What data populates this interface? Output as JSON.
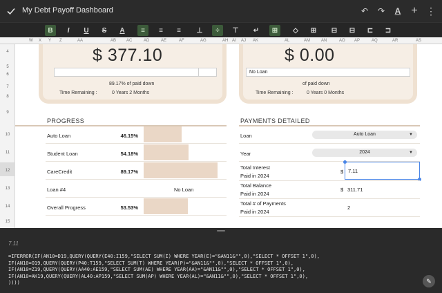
{
  "app": {
    "title": "My Debt Payoff Dashboard"
  },
  "columns": [
    "W",
    "X",
    "Y",
    "Z",
    "AA",
    "AB",
    "AC",
    "AD",
    "AE",
    "AF",
    "AG",
    "AH",
    "AI",
    "AJ",
    "AK",
    "AL",
    "AM",
    "AN",
    "AO",
    "AP",
    "AQ",
    "AR",
    "AS"
  ],
  "rows": [
    "4",
    "5",
    "6",
    "7",
    "8",
    "9",
    "10",
    "11",
    "12",
    "13",
    "14",
    "15"
  ],
  "summary_left": {
    "amount": "$ 377.10",
    "bar_label": "",
    "progress_fraction": 0.8917,
    "paid_text": "89.17%  of  paid down",
    "time_label": "Time Remaining :",
    "time_value": "0  Years  2  Months"
  },
  "summary_right": {
    "amount": "$ 0.00",
    "bar_label": "No Loan",
    "paid_text": "of  paid down",
    "time_label": "Time Remaining :",
    "time_value": "0  Years  0  Months"
  },
  "progress": {
    "title": "PROGRESS",
    "items": [
      {
        "label": "Auto Loan",
        "pct": "46.15%",
        "fraction": 0.4615,
        "no_loan": ""
      },
      {
        "label": "Student Loan",
        "pct": "54.18%",
        "fraction": 0.5418,
        "no_loan": ""
      },
      {
        "label": "CareCredit",
        "pct": "89.17%",
        "fraction": 0.8917,
        "no_loan": ""
      },
      {
        "label": "Loan #4",
        "pct": "",
        "fraction": 0,
        "no_loan": "No Loan"
      },
      {
        "label": "Overall Progress",
        "pct": "53.53%",
        "fraction": 0.5353,
        "no_loan": ""
      }
    ]
  },
  "payments": {
    "title": "PAYMENTS DETAILED",
    "loan_label": "Loan",
    "loan_value": "Auto Loan",
    "year_label": "Year",
    "year_value": "2024",
    "interest_label_1": "Total Interest",
    "interest_label_2": "Paid in 2024",
    "interest_currency": "$",
    "interest_value": "7.11",
    "balance_label_1": "Total Balance",
    "balance_label_2": "Paid in 2024",
    "balance_currency": "$",
    "balance_value": "311.71",
    "count_label_1": "Total # of Payments",
    "count_label_2": "Paid in 2024",
    "count_value": "2"
  },
  "formula": {
    "cell_value": "7.11",
    "line1": "=IFERROR(IF(AN10=D19,QUERY(QUERY(E40:I159,\"SELECT SUM(I) WHERE YEAR(E)=\"&AN11&\"\",0),\"SELECT * OFFSET 1\",0),",
    "line2": "IF(AN10=O19,QUERY(QUERY(P40:T159,\"SELECT SUM(T) WHERE YEAR(P)=\"&AN11&\"\",0),\"SELECT * OFFSET 1\",0),",
    "line3": "IF(AN10=Z19,QUERY(QUERY(AA40:AE159,\"SELECT SUM(AE) WHERE YEAR(AA)=\"&AN11&\"\",0),\"SELECT * OFFSET 1\",0),",
    "line4": "IF(AN10=AK19,QUERY(QUERY(AL40:AP159,\"SELECT SUM(AP) WHERE YEAR(AL)=\"&AN11&\"\",0),\"SELECT * OFFSET 1\",0),",
    "line5": "))))"
  }
}
